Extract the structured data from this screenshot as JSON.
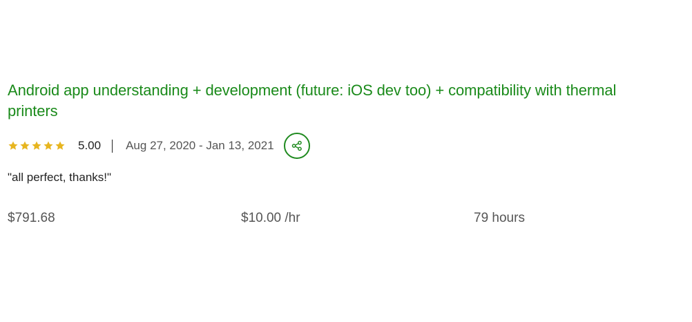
{
  "job": {
    "title": "Android app understanding + development (future: iOS dev too) + compatibility with thermal printers",
    "rating": {
      "stars_filled": 5,
      "stars_total": 5,
      "value": "5.00"
    },
    "date_range": "Aug 27, 2020 - Jan 13, 2021",
    "feedback": "\"all perfect, thanks!\"",
    "stats": {
      "earned": "$791.68",
      "rate": "$10.00 /hr",
      "hours": "79 hours"
    }
  },
  "icons": {
    "star": "star-icon",
    "share": "share-icon"
  },
  "colors": {
    "title_green": "#1a8a1a",
    "star_gold": "#e7b51f",
    "share_border": "#1f8a1f",
    "text_dark": "#222222",
    "text_muted": "#555555"
  }
}
